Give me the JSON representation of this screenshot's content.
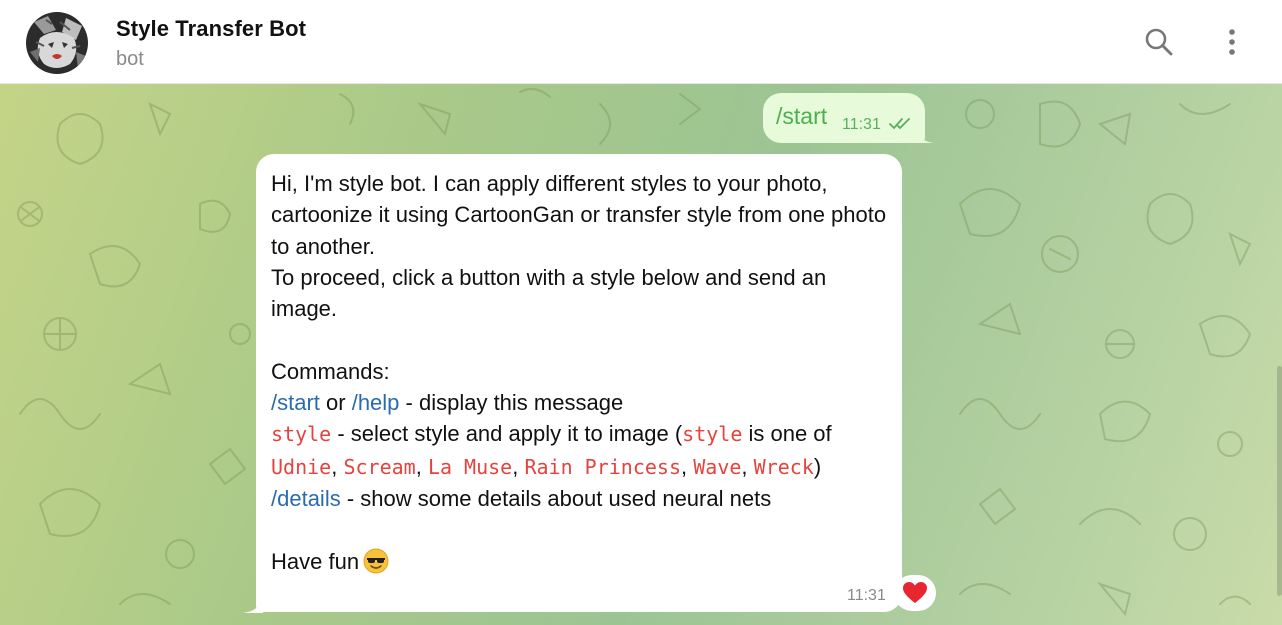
{
  "header": {
    "title": "Style Transfer Bot",
    "subtitle": "bot",
    "icons": {
      "search": "search-icon",
      "menu": "more-vertical-icon",
      "avatar": "bot-avatar"
    }
  },
  "messages": {
    "outgoing": {
      "text": "/start",
      "time": "11:31",
      "status": "double-check-icon"
    },
    "incoming": {
      "line1": "Hi, I'm style bot. I can apply different styles to your photo, cartoonize it using CartoonGan or transfer style from one photo to another.",
      "line2": "To proceed, click a button with a style below and send an image.",
      "commands_title": "Commands:",
      "cmd_start": "/start",
      "or_text": " or ",
      "cmd_help": "/help",
      "start_desc": " - display this message",
      "cmd_style": "style",
      "style_desc_a": " - select style and apply it to image (",
      "cmd_style2": "style",
      "style_desc_b": " is one of ",
      "styles": [
        "Udnie",
        "Scream",
        "La Muse",
        "Rain Princess",
        "Wave",
        "Wreck"
      ],
      "sep": ", ",
      "close_paren": ")",
      "cmd_details": "/details",
      "details_desc": " - show some details about used neural nets",
      "have_fun": "Have fun",
      "emoji": "smiling-face-with-sunglasses-icon",
      "time": "11:31",
      "reaction": "red-heart-icon"
    }
  },
  "colors": {
    "outgoing_bubble": "#e7fbdb",
    "outgoing_text": "#4caf50",
    "link": "#2a6bb0",
    "code": "#e5433e",
    "reaction": "#e8262f"
  }
}
